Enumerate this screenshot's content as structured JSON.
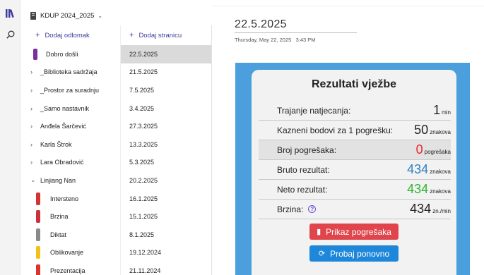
{
  "notebook": {
    "title": "KDUP 2024_2025"
  },
  "sections": {
    "add_label": "Dodaj odlomak",
    "items": [
      {
        "label": "Dobro došli",
        "color": "#7a2fa0",
        "kind": "tab"
      },
      {
        "label": "_Biblioteka sadržaja",
        "kind": "group"
      },
      {
        "label": "_Prostor za suradnju",
        "kind": "group"
      },
      {
        "label": "_Samo nastavnik",
        "kind": "group"
      },
      {
        "label": "Anđela Šarčević",
        "kind": "group"
      },
      {
        "label": "Karla Štrok",
        "kind": "group"
      },
      {
        "label": "Lara Obradović",
        "kind": "group"
      },
      {
        "label": "Linjiang Nan",
        "kind": "group-open"
      },
      {
        "label": "Intersteno",
        "color": "#d43434",
        "kind": "child"
      },
      {
        "label": "Brzina",
        "color": "#c8323c",
        "kind": "child"
      },
      {
        "label": "Diktat",
        "color": "#8a8a8a",
        "kind": "child"
      },
      {
        "label": "Oblikovanje",
        "color": "#f2c21c",
        "kind": "child"
      },
      {
        "label": "Prezentacija",
        "color": "#d8352f",
        "kind": "child"
      }
    ]
  },
  "pages": {
    "add_label": "Dodaj stranicu",
    "items": [
      "22.5.2025",
      "21.5.2025",
      "7.5.2025",
      "3.4.2025",
      "27.3.2025",
      "13.3.2025",
      "5.3.2025",
      "20.2.2025",
      "16.1.2025",
      "15.1.2025",
      "8.1.2025",
      "19.12.2024",
      "21.11.2024"
    ]
  },
  "content": {
    "title": "22.5.2025",
    "date": "Thursday, May 22, 2025",
    "time": "3:43 PM"
  },
  "results": {
    "title": "Rezultati vježbe",
    "rows": [
      {
        "label": "Trajanje natjecanja:",
        "value": "1",
        "unit": "min",
        "color": "#222222"
      },
      {
        "label": "Kazneni bodovi za 1 pogrešku:",
        "value": "50",
        "unit": "znakova",
        "color": "#222222"
      },
      {
        "label": "Broj pogrešaka:",
        "value": "0",
        "unit": "pogrešaka",
        "color": "#e8262c"
      },
      {
        "label": "Bruto rezultat:",
        "value": "434",
        "unit": "znakova",
        "color": "#2f7fc1"
      },
      {
        "label": "Neto rezultat:",
        "value": "434",
        "unit": "znakova",
        "color": "#2fb52f"
      },
      {
        "label": "Brzina:",
        "value": "434",
        "unit": "zn./min",
        "color": "#222222"
      }
    ],
    "btn_errors": "Prikaz pogrešaka",
    "btn_retry": "Probaj ponovno"
  },
  "colors": {
    "blue_bg": "#4a9fdc",
    "accent": "#3d3d9e"
  }
}
